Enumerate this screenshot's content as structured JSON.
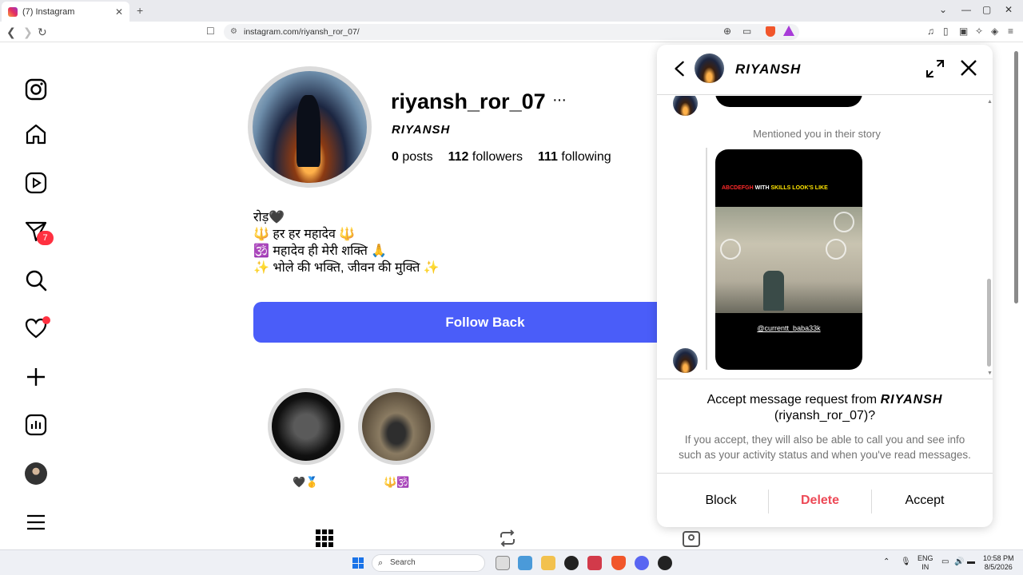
{
  "browser": {
    "tab_title": "(7) Instagram",
    "url": "instagram.com/riyansh_ror_07/",
    "window_controls": [
      "⌄",
      "—",
      "▢",
      "✕"
    ]
  },
  "sidebar": {
    "notification_count": "7",
    "items": [
      "instagram-logo",
      "home",
      "reels",
      "messages",
      "search",
      "notifications",
      "create",
      "dashboard",
      "profile",
      "more"
    ]
  },
  "profile": {
    "username": "riyansh_ror_07",
    "more": "···",
    "full_name": "RIYANSH",
    "stats": {
      "posts_count": "0",
      "posts_label": "posts",
      "followers_count": "112",
      "followers_label": "followers",
      "following_count": "111",
      "following_label": "following"
    },
    "bio": [
      "रोड़🖤",
      "🔱 हर हर महादेव 🔱",
      "🕉️ महादेव ही मेरी शक्ति 🙏",
      "✨ भोले की भक्ति, जीवन की मुक्ति ✨"
    ],
    "follow_back_label": "Follow Back",
    "highlights": [
      {
        "label": "🖤🥇"
      },
      {
        "label": "🔱🕉️"
      }
    ]
  },
  "dm": {
    "name": "RIYANSH",
    "mention_text": "Mentioned you in their story",
    "story": {
      "title_red": "ABCDEFGH",
      "title_white": " WITH ",
      "title_yellow": "SKILLS LOOK'S LIKE",
      "handle": "@currentt_baba33k"
    },
    "request": {
      "prefix": "Accept message request from ",
      "name": "RIYANSH",
      "username_line": "(riyansh_ror_07)?",
      "subtitle": "If you accept, they will also be able to call you and see info such as your activity status and when you've read messages."
    },
    "actions": {
      "block": "Block",
      "delete": "Delete",
      "accept": "Accept"
    }
  },
  "taskbar": {
    "search_placeholder": "Search",
    "lang_line1": "ENG",
    "lang_line2": "IN",
    "time": "10:58 PM",
    "date": "8/5/2026"
  },
  "colors": {
    "follow_button": "#4a5df9",
    "delete_text": "#ed4956",
    "notification_badge": "#ff3040"
  }
}
